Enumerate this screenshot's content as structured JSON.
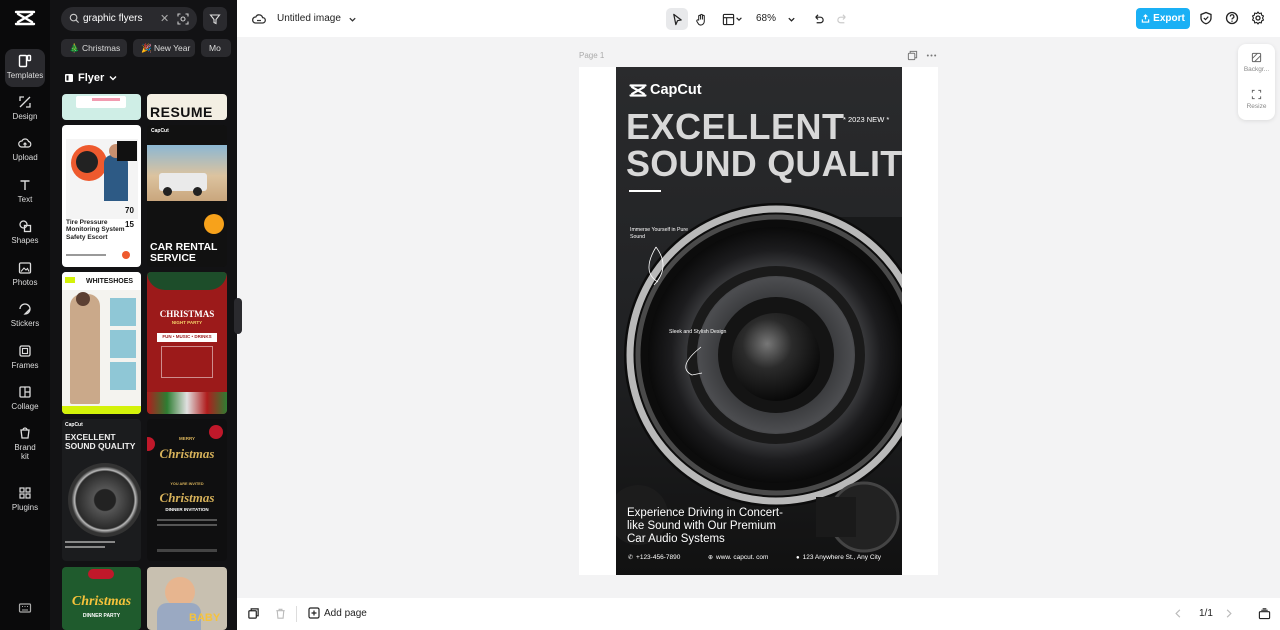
{
  "app": {
    "rail": [
      {
        "label": "Templates",
        "icon": "templates-icon"
      },
      {
        "label": "Design",
        "icon": "design-icon"
      },
      {
        "label": "Upload",
        "icon": "upload-icon"
      },
      {
        "label": "Text",
        "icon": "text-icon"
      },
      {
        "label": "Shapes",
        "icon": "shapes-icon"
      },
      {
        "label": "Photos",
        "icon": "photos-icon"
      },
      {
        "label": "Stickers",
        "icon": "stickers-icon"
      },
      {
        "label": "Frames",
        "icon": "frames-icon"
      },
      {
        "label": "Collage",
        "icon": "collage-icon"
      },
      {
        "label": "Brand\nkit",
        "icon": "brand-kit-icon"
      },
      {
        "label": "Plugins",
        "icon": "plugins-icon"
      }
    ]
  },
  "panel": {
    "search_value": "graphic flyers",
    "chips": [
      "🎄 Christmas",
      "🎉 New Year",
      "Mo"
    ],
    "category": "Flyer",
    "thumbs": {
      "resume": "RESUME",
      "tire_title": "Tire Pressure Monitoring System Safety Escort",
      "tire_nums": [
        "70",
        "15"
      ],
      "car_brand": "CapCut",
      "car_title": "CAR RENTAL SERVICE",
      "shoes_brand": "WHITESHOES",
      "xmas_party_title": "CHRISTMAS",
      "xmas_party_sub": "NIGHT PARTY",
      "xmas_party_bar": "FUN • MUSIC • DRINKS",
      "sound_brand": "CapCut",
      "sound_title": "EXCELLENT SOUND QUALITY",
      "merry": "MERRY",
      "xmas_script": "Christmas",
      "invited": "YOU ARE INVITED",
      "xmas_script2": "Christmas",
      "dinner_invite": "DINNER INVITATION",
      "xmas_dinner": "Christmas",
      "dinner_party": "DINNER PARTY",
      "baby": "BABY"
    }
  },
  "topbar": {
    "title": "Untitled image",
    "zoom": "68%",
    "export_label": "Export"
  },
  "canvas": {
    "page_label": "Page 1",
    "flyer": {
      "brand": "CapCut",
      "year_tag": "* 2023  NEW *",
      "headline_1": "EXCELLENT",
      "headline_2": "SOUND QUALITY",
      "note_1": "Immerse Yourself in Pure Sound",
      "note_2": "Sleek and Stylish Design",
      "tagline": "Experience Driving in Concert-like Sound with Our Premium Car Audio Systems",
      "phone": "+123-456-7890",
      "web": "www. capcut. com",
      "address": "123 Anywhere St., Any City"
    }
  },
  "right_tools": {
    "background_label": "Backgr...",
    "resize_label": "Resize"
  },
  "bottombar": {
    "add_page": "Add page",
    "pager": "1/1"
  },
  "colors": {
    "accent": "#1ab0f5",
    "rail_bg": "#0a0a0b",
    "panel_bg": "#121214",
    "canvas_bg": "#f3f3f4"
  }
}
